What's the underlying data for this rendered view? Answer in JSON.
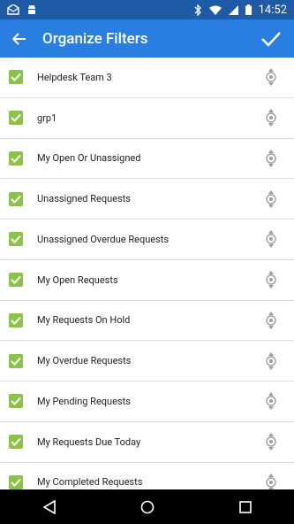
{
  "status_bar": {
    "time": "14:52"
  },
  "app_bar": {
    "title": "Organize Filters"
  },
  "filters": [
    {
      "label": "Helpdesk Team 3"
    },
    {
      "label": "grp1"
    },
    {
      "label": "My Open Or Unassigned"
    },
    {
      "label": "Unassigned Requests"
    },
    {
      "label": "Unassigned Overdue Requests"
    },
    {
      "label": "My Open Requests"
    },
    {
      "label": "My Requests On Hold"
    },
    {
      "label": "My Overdue Requests"
    },
    {
      "label": "My Pending Requests"
    },
    {
      "label": "My Requests Due Today"
    },
    {
      "label": "My Completed Requests"
    }
  ],
  "colors": {
    "status_bar": "#1f5aa6",
    "app_bar": "#2a7de1",
    "checkbox": "#8bc34a",
    "divider": "#dcdcdc"
  },
  "icons": {
    "back": "arrow-back-icon",
    "confirm": "check-icon",
    "drag": "drag-handle-icon",
    "nav_back": "triangle-back-icon",
    "nav_home": "circle-home-icon",
    "nav_recents": "square-recents-icon"
  }
}
